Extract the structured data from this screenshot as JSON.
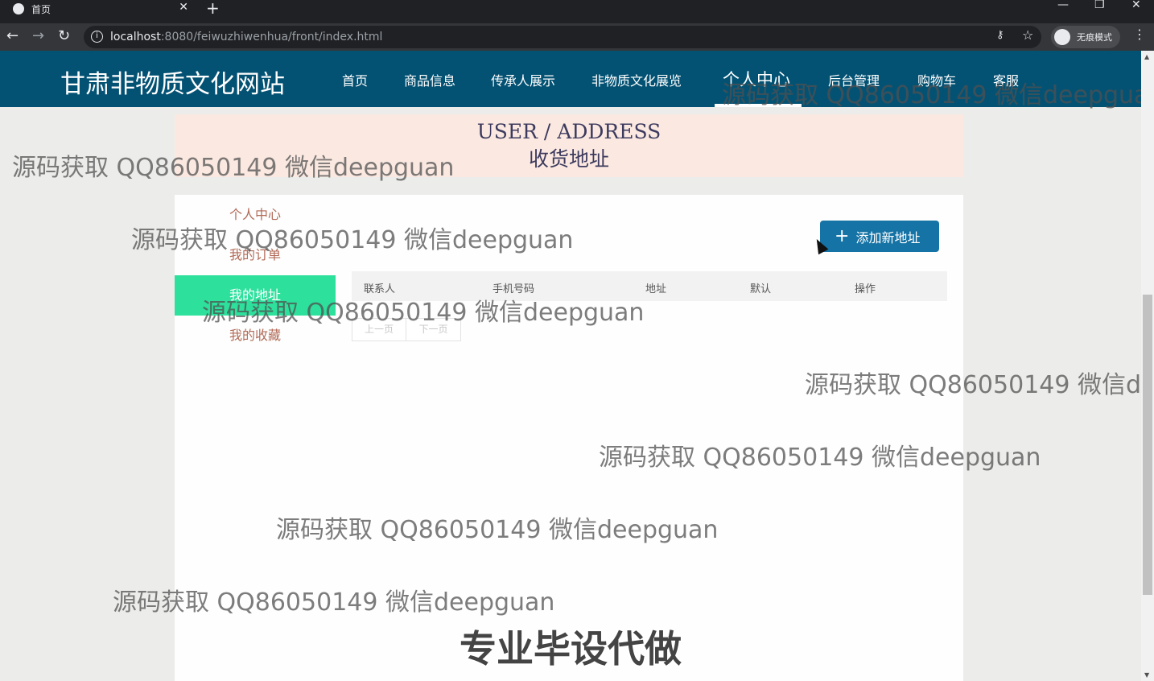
{
  "browser": {
    "tab_title": "首页",
    "tab_close": "✕",
    "new_tab": "+",
    "url_host": "localhost",
    "url_rest": ":8080/feiwuzhiwenhua/front/index.html",
    "incognito_label": "无痕模式",
    "window_min": "—",
    "window_restore": "❐",
    "window_close": "✕"
  },
  "site": {
    "title": "甘肃非物质文化网站",
    "nav": [
      {
        "label": "首页"
      },
      {
        "label": "商品信息"
      },
      {
        "label": "传承人展示"
      },
      {
        "label": "非物质文化展览"
      },
      {
        "label": "个人中心",
        "active": true
      },
      {
        "label": "后台管理"
      },
      {
        "label": "购物车"
      },
      {
        "label": "客服"
      }
    ]
  },
  "hero": {
    "en": "USER / ADDRESS",
    "zh": "收货地址"
  },
  "sidebar": {
    "items": [
      {
        "label": "个人中心"
      },
      {
        "label": "我的订单"
      },
      {
        "label": "我的地址",
        "active": true
      },
      {
        "label": "我的收藏"
      }
    ]
  },
  "main": {
    "add_button": "添加新地址",
    "table_headers": [
      "联系人",
      "手机号码",
      "地址",
      "默认",
      "操作"
    ],
    "pager": {
      "prev": "上一页",
      "next": "下一页"
    }
  },
  "watermarks": {
    "text": "源码获取 QQ86050149 微信deepguan",
    "text_partial": "源码获取 QQ86050149 微信dee",
    "big": "专业毕设代做"
  },
  "colors": {
    "header_bg": "#045273",
    "sidebar_active": "#2de09c",
    "add_button_bg": "#1573a5",
    "hero_bg": "#fbe9e1"
  }
}
